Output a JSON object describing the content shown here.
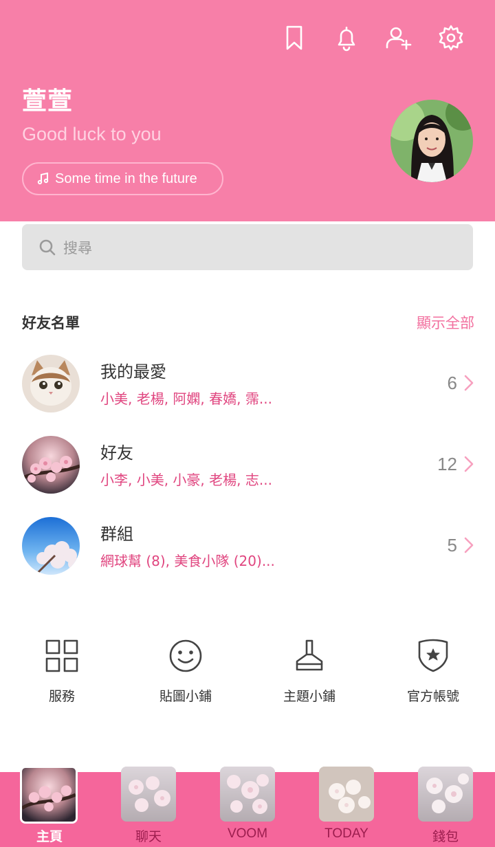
{
  "colors": {
    "header_bg": "#f77fa8",
    "accent": "#f26f9e",
    "subtext_pink": "#e0457f",
    "nav_bg": "#f5669b"
  },
  "header": {
    "icons": [
      "bookmark-icon",
      "bell-icon",
      "add-friend-icon",
      "settings-icon"
    ],
    "profile": {
      "name": "萱萱",
      "status_message": "Good luck to you",
      "music": "Some time in the future"
    }
  },
  "search": {
    "placeholder": "搜尋"
  },
  "friends_section": {
    "title": "好友名單",
    "show_all": "顯示全部",
    "items": [
      {
        "title": "我的最愛",
        "subtitle": "小美, 老楊, 阿嫻, 春嬌, 霈...",
        "count": "6"
      },
      {
        "title": "好友",
        "subtitle": "小李, 小美, 小豪, 老楊, 志...",
        "count": "12"
      },
      {
        "title": "群組",
        "subtitle": "網球幫 (8), 美食小隊 (20)...",
        "count": "5"
      }
    ]
  },
  "shortcuts": [
    {
      "label": "服務",
      "icon": "grid-icon"
    },
    {
      "label": "貼圖小鋪",
      "icon": "smiley-icon"
    },
    {
      "label": "主題小鋪",
      "icon": "brush-icon"
    },
    {
      "label": "官方帳號",
      "icon": "shield-star-icon"
    }
  ],
  "bottom_nav": [
    {
      "label": "主頁",
      "active": true
    },
    {
      "label": "聊天",
      "active": false
    },
    {
      "label": "VOOM",
      "active": false
    },
    {
      "label": "TODAY",
      "active": false
    },
    {
      "label": "錢包",
      "active": false
    }
  ]
}
